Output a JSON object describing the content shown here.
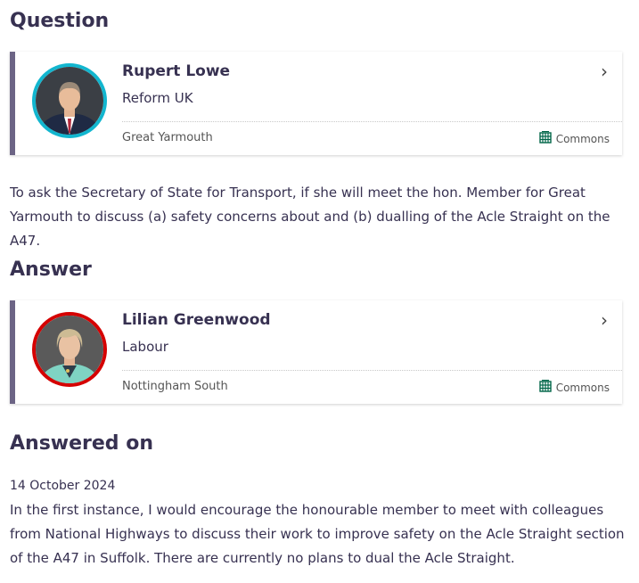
{
  "question": {
    "heading": "Question",
    "member": {
      "name": "Rupert Lowe",
      "party": "Reform UK",
      "constituency": "Great Yarmouth",
      "house": "Commons",
      "party_color": "#12B6CF"
    },
    "text": "To ask the Secretary of State for Transport, if she will meet the hon. Member for Great Yarmouth to discuss (a) safety concerns about and (b) dualling of the Acle Straight on the A47."
  },
  "answer": {
    "heading": "Answer",
    "member": {
      "name": "Lilian Greenwood",
      "party": "Labour",
      "constituency": "Nottingham South",
      "house": "Commons",
      "party_color": "#D50000"
    }
  },
  "answered_on": {
    "heading": "Answered on",
    "date": "14 October 2024",
    "text": "In the first instance, I would encourage the honourable member to meet with colleagues from National Highways to discuss their work to improve safety on the Acle Straight section of the A47 in Suffolk. There are currently no plans to dual the Acle Straight."
  },
  "colors": {
    "heading": "#373151",
    "card_accent": "#6C6485",
    "commons_green": "#006548"
  },
  "icons": {
    "chevron": "chevron-right-icon",
    "house": "portcullis-icon"
  }
}
